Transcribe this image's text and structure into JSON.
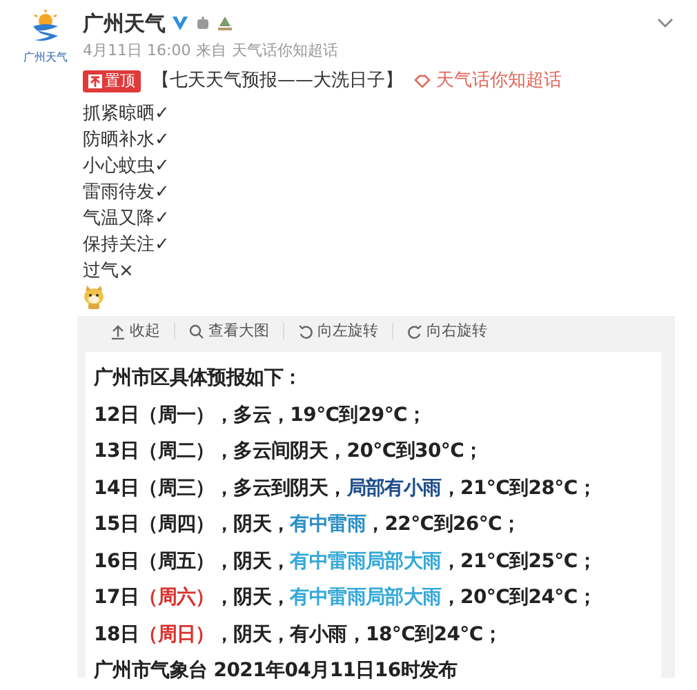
{
  "author": {
    "avatar_caption": "广州天气",
    "name": "广州天气",
    "verified": true
  },
  "meta": {
    "time": "4月11日 16:00",
    "from": "来自",
    "source": "天气话你知超话"
  },
  "pinned": {
    "badge": "置顶",
    "title": "【七天天气预报——大洗日子】",
    "topic": "天气话你知超话"
  },
  "lines": [
    "抓紧晾晒✓",
    "防晒补水✓",
    "小心蚊虫✓",
    "雷雨待发✓",
    "气温又降✓",
    "保持关注✓",
    "过气×"
  ],
  "toolbar": [
    "收起",
    "查看大图",
    "向左旋转",
    "向右旋转"
  ],
  "forecast": {
    "heading": "广州市区具体预报如下：",
    "rows": [
      [
        {
          "text": "12日（周一），多云，19°C到29°C；",
          "color": "#222222"
        }
      ],
      [
        {
          "text": "13日（周二），多云间阴天，20°C到30°C；",
          "color": "#222222"
        }
      ],
      [
        {
          "text": "14日（周三），多云到阴天，",
          "color": "#222222"
        },
        {
          "text": "局部有小雨",
          "color": "#1f4e8c"
        },
        {
          "text": "，21°C到28°C；",
          "color": "#222222"
        }
      ],
      [
        {
          "text": "15日（周四），阴天，",
          "color": "#222222"
        },
        {
          "text": "有中雷雨",
          "color": "#2a8fc7"
        },
        {
          "text": "，22°C到26°C；",
          "color": "#222222"
        }
      ],
      [
        {
          "text": "16日（周五），阴天，",
          "color": "#222222"
        },
        {
          "text": "有中雷雨局部大雨",
          "color": "#35a9db"
        },
        {
          "text": "，21°C到25°C；",
          "color": "#222222"
        }
      ],
      [
        {
          "text": "17日",
          "color": "#222222"
        },
        {
          "text": "（周六）",
          "color": "#d8322d"
        },
        {
          "text": "，阴天，",
          "color": "#222222"
        },
        {
          "text": "有中雷雨局部大雨",
          "color": "#35a9db"
        },
        {
          "text": "，20°C到24°C；",
          "color": "#222222"
        }
      ],
      [
        {
          "text": "18日",
          "color": "#222222"
        },
        {
          "text": "（周日）",
          "color": "#d8322d"
        },
        {
          "text": "，阴天，有小雨，18°C到24°C；",
          "color": "#222222"
        }
      ]
    ],
    "footer": "广州市气象台 2021年04月11日16时发布"
  }
}
